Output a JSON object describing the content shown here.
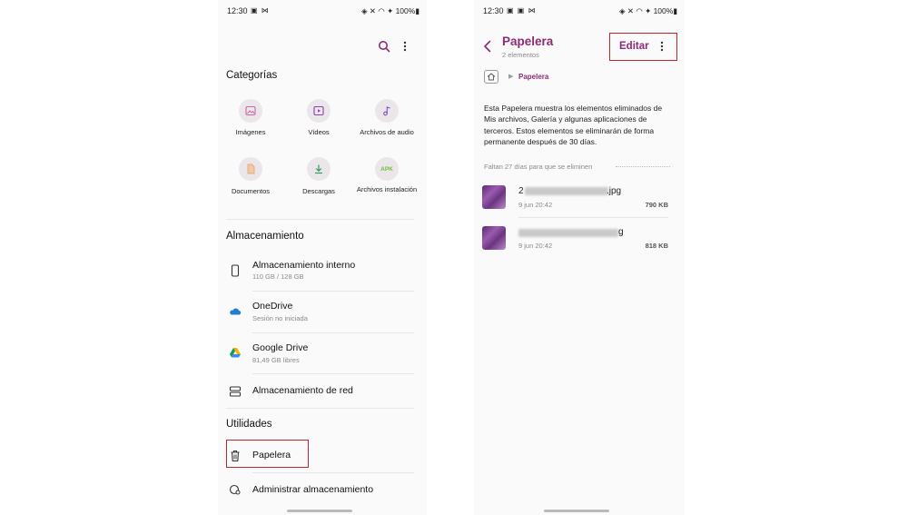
{
  "left": {
    "status": {
      "time": "12:30",
      "left_icons": "▣ ⋈",
      "right": "◈ ✕ ◠ ✦ 100%▮"
    },
    "categories_title": "Categorías",
    "categories": [
      {
        "label": "Imágenes",
        "icon": "image-icon"
      },
      {
        "label": "Vídeos",
        "icon": "video-icon"
      },
      {
        "label": "Archivos de audio",
        "icon": "audio-icon"
      },
      {
        "label": "Documentos",
        "icon": "document-icon"
      },
      {
        "label": "Descargas",
        "icon": "download-icon"
      },
      {
        "label": "Archivos instalación",
        "icon": "apk-icon",
        "badge": "APK"
      }
    ],
    "storage_title": "Almacenamiento",
    "storage": [
      {
        "title": "Almacenamiento interno",
        "sub": "110 GB / 128 GB",
        "icon": "phone-icon"
      },
      {
        "title": "OneDrive",
        "sub": "Sesión no iniciada",
        "icon": "onedrive-icon"
      },
      {
        "title": "Google Drive",
        "sub": "81,49 GB libres",
        "icon": "google-drive-icon"
      },
      {
        "title": "Almacenamiento de red",
        "sub": "",
        "icon": "network-storage-icon"
      }
    ],
    "utilities_title": "Utilidades",
    "utilities": [
      {
        "title": "Papelera",
        "icon": "trash-icon"
      },
      {
        "title": "Administrar almacenamiento",
        "icon": "manage-storage-icon"
      }
    ],
    "colors": {
      "accent": "#8e2a74"
    }
  },
  "right": {
    "status": {
      "time": "12:30",
      "left_icons": "▣ ▣ ⋈",
      "right": "◈ ✕ ◠ ✦ 100%▮"
    },
    "title": "Papelera",
    "subtitle": "2 elementos",
    "edit_label": "Editar",
    "breadcrumb": "Papelera",
    "info": "Esta Papelera muestra los elementos eliminados de Mis archivos, Galería y algunas aplicaciones de terceros. Estos elementos se eliminarán de forma permanente después de 30 días.",
    "days_left": "Faltan 27 días para que se eliminen",
    "files": [
      {
        "name_start": "2",
        "name_end": ".jpg",
        "date": "9 jun 20:42",
        "size": "790 KB"
      },
      {
        "name_start": "",
        "name_end": "g",
        "date": "9 jun 20:42",
        "size": "818 KB"
      }
    ],
    "colors": {
      "title": "#8e2a74",
      "highlight": "#c8232c"
    }
  }
}
